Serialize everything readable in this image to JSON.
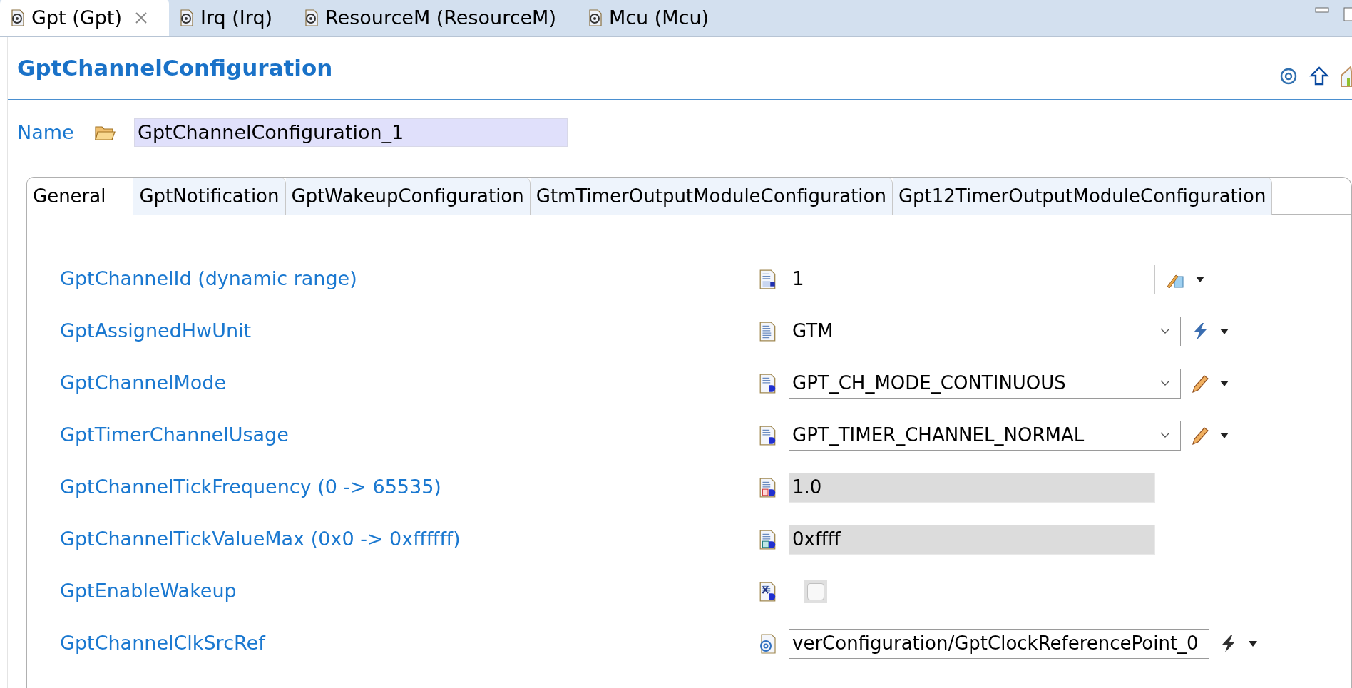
{
  "editor_tabs": [
    {
      "label": "Gpt (Gpt)",
      "selected": true,
      "closable": true
    },
    {
      "label": "Irq (Irq)",
      "selected": false,
      "closable": false
    },
    {
      "label": "ResourceM (ResourceM)",
      "selected": false,
      "closable": false
    },
    {
      "label": "Mcu (Mcu)",
      "selected": false,
      "closable": false
    }
  ],
  "page": {
    "title": "GptChannelConfiguration"
  },
  "name": {
    "label": "Name",
    "value": "GptChannelConfiguration_1"
  },
  "tabs": [
    {
      "label": "General",
      "selected": true
    },
    {
      "label": "GptNotification",
      "selected": false
    },
    {
      "label": "GptWakeupConfiguration",
      "selected": false
    },
    {
      "label": "GtmTimerOutputModuleConfiguration",
      "selected": false
    },
    {
      "label": "Gpt12TimerOutputModuleConfiguration",
      "selected": false
    }
  ],
  "parameters": [
    {
      "label": "GptChannelId (dynamic range)",
      "kind": "integer",
      "value": "1",
      "readonly": false
    },
    {
      "label": "GptAssignedHwUnit",
      "kind": "string",
      "value": "GTM",
      "readonly": false
    },
    {
      "label": "GptChannelMode",
      "kind": "enum",
      "value": "GPT_CH_MODE_CONTINUOUS",
      "readonly": false
    },
    {
      "label": "GptTimerChannelUsage",
      "kind": "enum",
      "value": "GPT_TIMER_CHANNEL_NORMAL",
      "readonly": false
    },
    {
      "label": "GptChannelTickFrequency (0 -> 65535)",
      "kind": "float",
      "value": "1.0",
      "readonly": true
    },
    {
      "label": "GptChannelTickValueMax (0x0 -> 0xffffff)",
      "kind": "hex",
      "value": "0xffff",
      "readonly": true
    },
    {
      "label": "GptEnableWakeup",
      "kind": "boolean",
      "checked": false
    },
    {
      "label": "GptChannelClkSrcRef",
      "kind": "reference",
      "value": "verConfiguration/GptClockReferencePoint_0",
      "readonly": false
    }
  ]
}
